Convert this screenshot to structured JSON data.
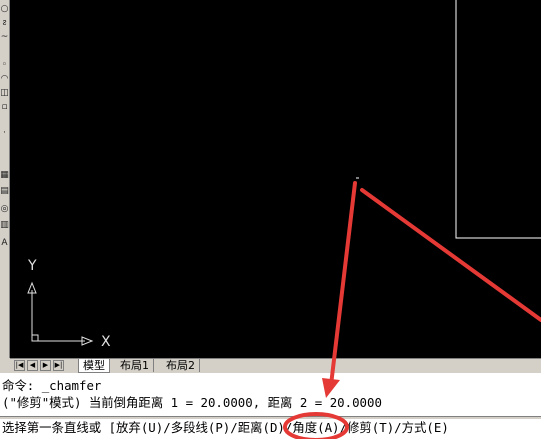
{
  "toolbar": {
    "icons": [
      "circle-icon",
      "revision-cloud-icon",
      "spline-icon",
      "ellipse-icon",
      "ellipse-arc-icon",
      "insert-block-icon",
      "make-block-icon",
      "point-icon",
      "hatch-icon",
      "gradient-icon",
      "region-icon",
      "table-icon",
      "mtext-icon"
    ]
  },
  "ucs": {
    "y_label": "Y",
    "x_label": "X"
  },
  "tabs": {
    "nav": [
      "|◀",
      "◀",
      "▶",
      "▶|"
    ],
    "items": [
      {
        "label": "模型",
        "active": true
      },
      {
        "label": "布局1",
        "active": false
      },
      {
        "label": "布局2",
        "active": false
      }
    ]
  },
  "command": {
    "line1": "命令: _chamfer",
    "line2": "(\"修剪\"模式) 当前倒角距离 1 = 20.0000, 距离 2 = 20.0000",
    "line3_prefix": "选择第一条直线或 [",
    "options": [
      {
        "label": "放弃(U)"
      },
      {
        "label": "多段线(P)"
      },
      {
        "label": "距离(D)"
      },
      {
        "label": "角度(A)"
      },
      {
        "label": "修剪(T)"
      },
      {
        "label": "方式(E)"
      }
    ],
    "option_separator": "/"
  },
  "annotation": {
    "color": "#e53935",
    "highlighted_option": "距离(D)"
  }
}
